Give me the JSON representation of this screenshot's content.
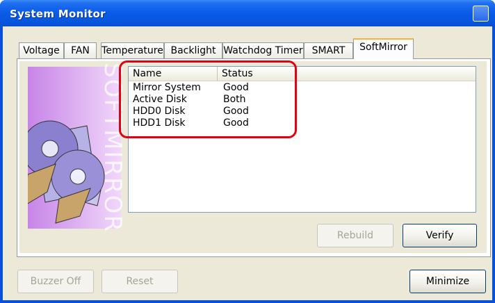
{
  "window": {
    "title": "System Monitor"
  },
  "tabs": [
    {
      "label": "Voltage"
    },
    {
      "label": "FAN"
    },
    {
      "label": "Temperature"
    },
    {
      "label": "Backlight"
    },
    {
      "label": "Watchdog Timer"
    },
    {
      "label": "SMART"
    },
    {
      "label": "SoftMirror",
      "active": true
    }
  ],
  "art": {
    "text": "SOFTMIRROR"
  },
  "table": {
    "columns": [
      "Name",
      "Status"
    ],
    "rows": [
      {
        "name": "Mirror System",
        "status": "Good"
      },
      {
        "name": "Active Disk",
        "status": "Both"
      },
      {
        "name": "HDD0 Disk",
        "status": "Good"
      },
      {
        "name": "HDD1 Disk",
        "status": "Good"
      }
    ]
  },
  "buttons": {
    "rebuild": "Rebuild",
    "verify": "Verify",
    "buzzer_off": "Buzzer Off",
    "reset": "Reset",
    "minimize": "Minimize"
  },
  "colors": {
    "highlight": "#e30010",
    "titlebar": "#0b5ce8",
    "active_tab": "#f5b33b"
  }
}
